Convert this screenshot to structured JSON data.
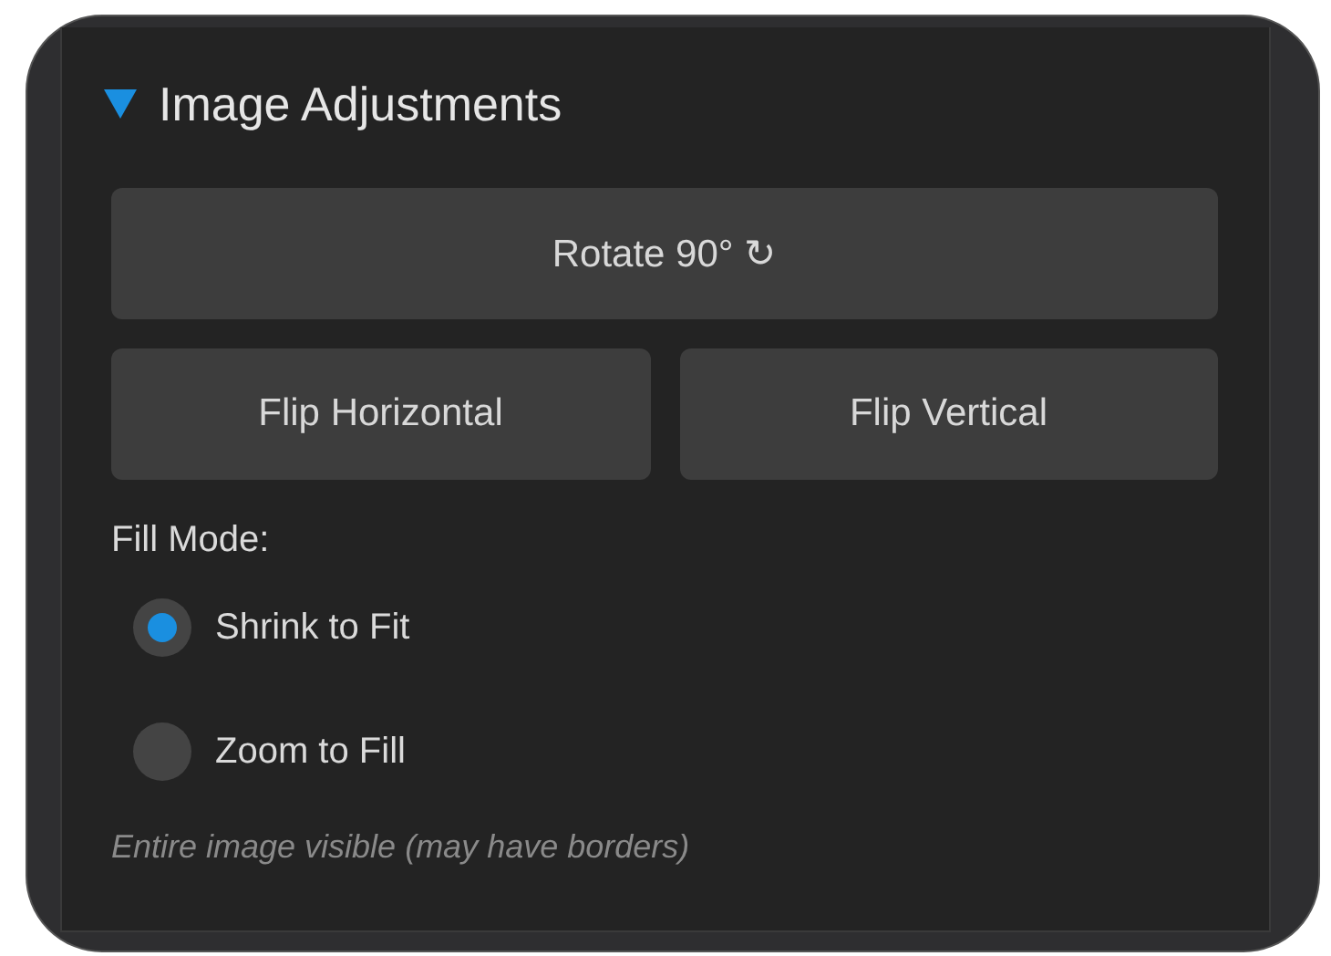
{
  "section": {
    "title": "Image Adjustments",
    "expanded": true
  },
  "buttons": [
    {
      "label": "Rotate 90° ↻",
      "kind": "wide"
    },
    {
      "label": "Flip Horizontal",
      "kind": "half"
    },
    {
      "label": "Flip Vertical",
      "kind": "half"
    }
  ],
  "fill_mode": {
    "label": "Fill Mode:",
    "options": [
      {
        "label": "Shrink to Fit",
        "selected": true
      },
      {
        "label": "Zoom to Fill",
        "selected": false
      }
    ],
    "hint": "Entire image visible (may have borders)"
  }
}
